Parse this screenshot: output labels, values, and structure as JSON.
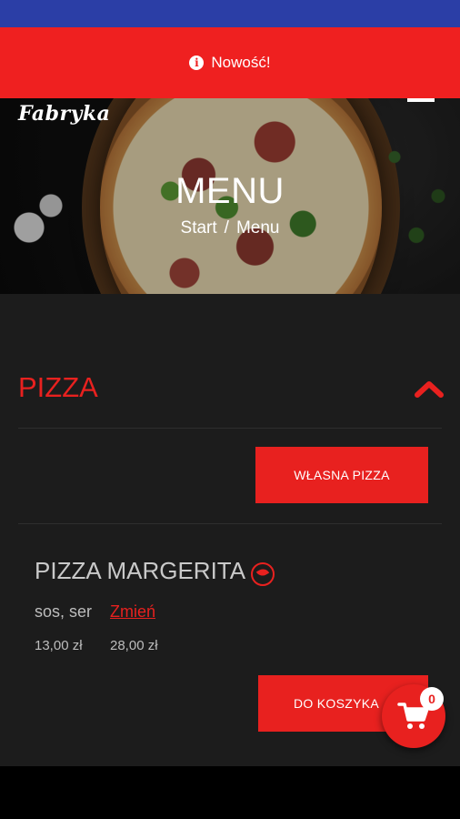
{
  "notice": {
    "text": "Nowość!",
    "icon": "info-icon"
  },
  "hero": {
    "logo_text": "Fabryka",
    "title": "MENU",
    "breadcrumb": {
      "home": "Start",
      "separator": "/",
      "current": "Menu"
    }
  },
  "section": {
    "title": "PIZZA",
    "expanded": true
  },
  "custom_pizza_button": "WŁASNA PIZZA",
  "product": {
    "name": "PIZZA MARGERITA",
    "ingredients": "sos, ser",
    "change_link": "Zmień",
    "prices": [
      "13,00 zł",
      "28,00 zł"
    ],
    "add_to_cart": "DO KOSZYKA"
  },
  "cart": {
    "count": "0",
    "icon": "cart-icon"
  },
  "colors": {
    "status_bar": "#2b3ea6",
    "accent": "#e8211f",
    "background": "#1c1c1c"
  }
}
